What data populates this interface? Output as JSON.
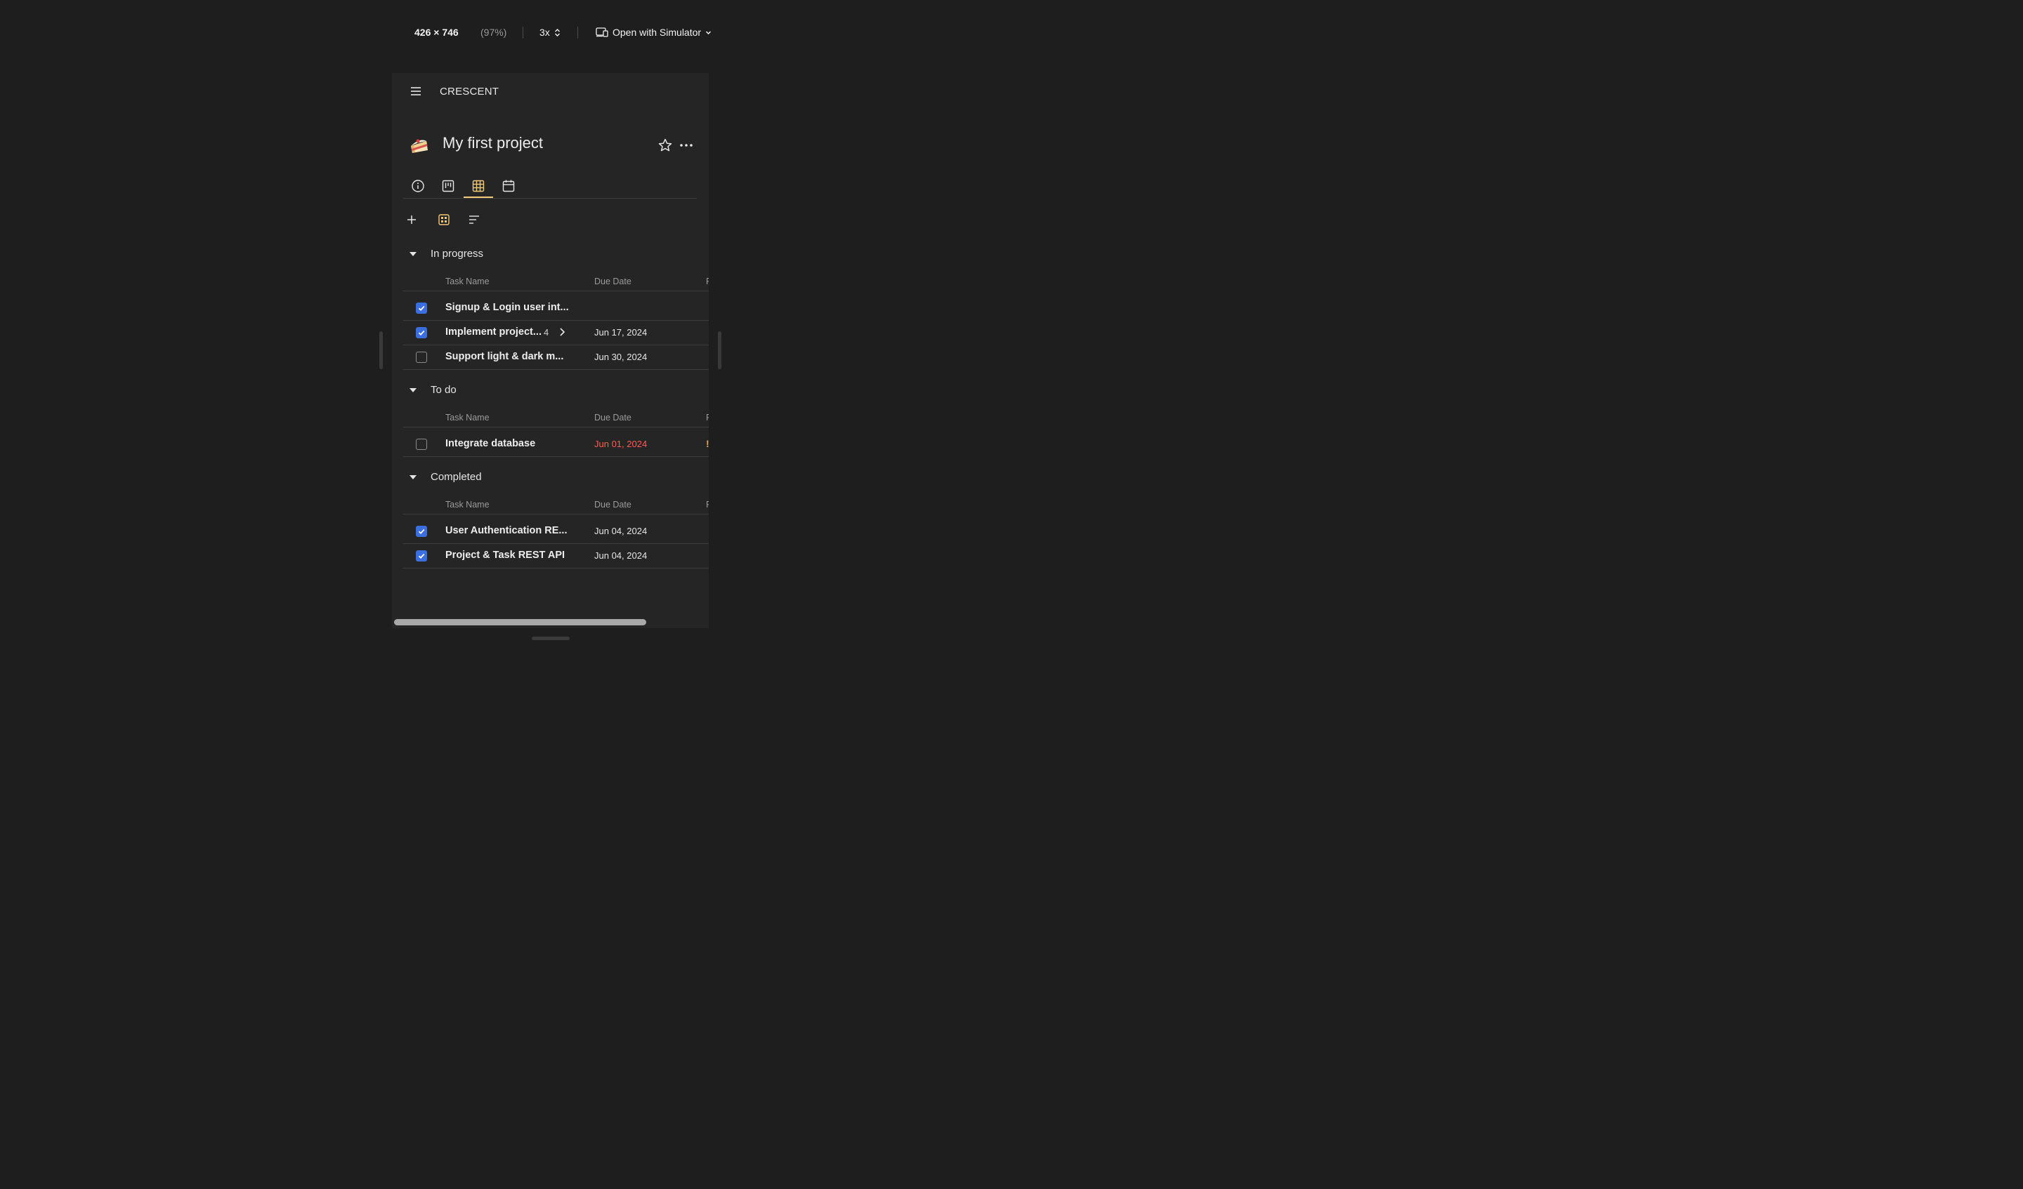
{
  "toolbar": {
    "dimensions": "426 × 746",
    "zoom": "(97%)",
    "scale": "3x",
    "open_with": "Open with Simulator"
  },
  "app": {
    "brand": "CRESCENT",
    "project_title": "My first project",
    "project_icon": "cake-emoji"
  },
  "tabs": [
    {
      "icon": "info-icon",
      "active": false
    },
    {
      "icon": "board-icon",
      "active": false
    },
    {
      "icon": "table-icon",
      "active": true
    },
    {
      "icon": "calendar-icon",
      "active": false
    }
  ],
  "columns": {
    "task_name": "Task Name",
    "due_date": "Due Date",
    "third_partial": "P"
  },
  "sections": [
    {
      "title": "In progress",
      "tasks": [
        {
          "name": "Signup & Login user int...",
          "due": "",
          "done": true
        },
        {
          "name": "Implement project...",
          "subtasks": "4",
          "due": "Jun 17, 2024",
          "done": true
        },
        {
          "name": "Support light & dark m...",
          "due": "Jun 30, 2024",
          "done": false
        }
      ]
    },
    {
      "title": "To do",
      "tasks": [
        {
          "name": "Integrate database",
          "due": "Jun 01, 2024",
          "done": false,
          "overdue": true,
          "priority": "!"
        }
      ]
    },
    {
      "title": "Completed",
      "tasks": [
        {
          "name": "User Authentication RE...",
          "due": "Jun 04, 2024",
          "done": true
        },
        {
          "name": "Project & Task REST API",
          "due": "Jun 04, 2024",
          "done": true
        }
      ]
    }
  ],
  "colors": {
    "accent": "#f3c97a",
    "checkbox": "#3b6fe0",
    "overdue": "#ff5b4f",
    "priority": "#f0a23a"
  }
}
